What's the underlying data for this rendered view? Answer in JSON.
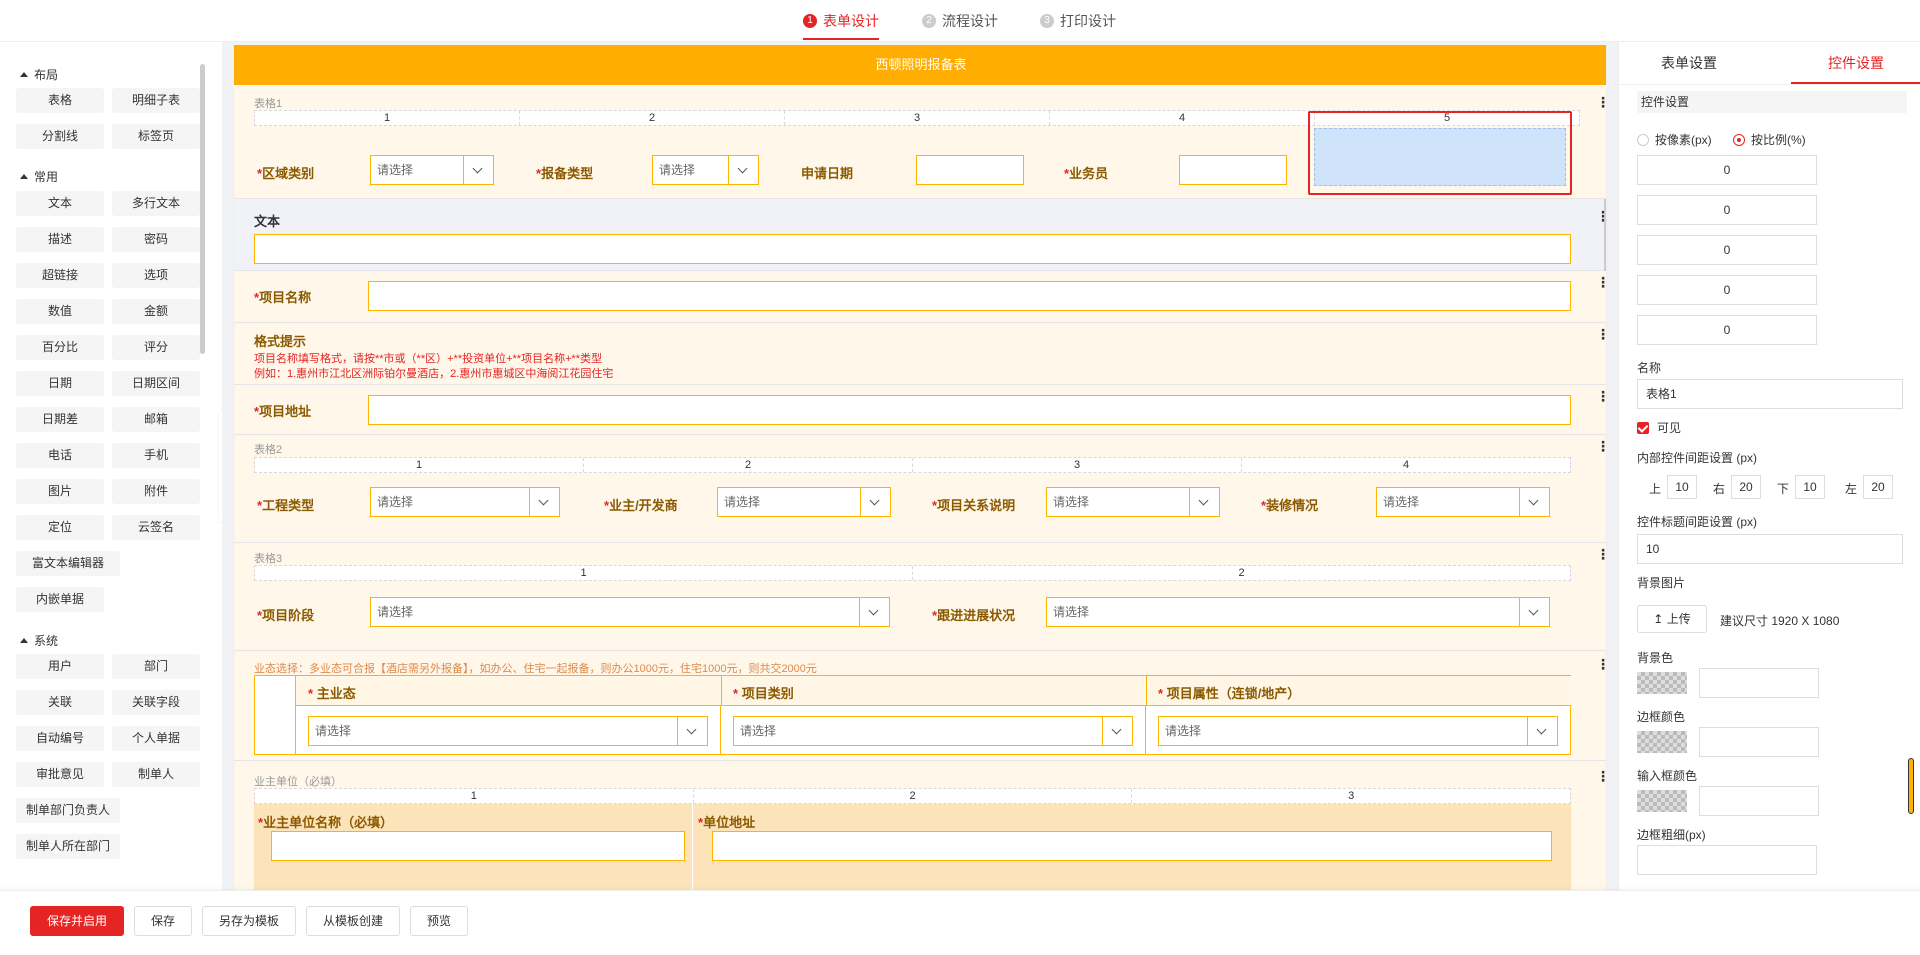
{
  "steps": [
    {
      "num": "1",
      "label": "表单设计"
    },
    {
      "num": "2",
      "label": "流程设计"
    },
    {
      "num": "3",
      "label": "打印设计"
    }
  ],
  "palette": {
    "groups": {
      "layout": "布局",
      "common": "常用",
      "system": "系统"
    },
    "layout": [
      "表格",
      "明细子表",
      "分割线",
      "标签页"
    ],
    "common": [
      "文本",
      "多行文本",
      "描述",
      "密码",
      "超链接",
      "选项",
      "数值",
      "金额",
      "百分比",
      "评分",
      "日期",
      "日期区间",
      "日期差",
      "邮箱",
      "电话",
      "手机",
      "图片",
      "附件",
      "定位",
      "云签名",
      "富文本编辑器",
      "内嵌单据"
    ],
    "system": [
      "用户",
      "部门",
      "关联",
      "关联字段",
      "自动编号",
      "个人单据",
      "审批意见",
      "制单人",
      "制单部门负责人",
      "制单人所在部门"
    ]
  },
  "form": {
    "title": "西顿照明报备表",
    "table1": {
      "label": "表格1",
      "cols": [
        "1",
        "2",
        "3",
        "4",
        "5"
      ],
      "fields": [
        {
          "label": "区域类别",
          "required": true,
          "type": "select",
          "value": "请选择"
        },
        {
          "label": "报备类型",
          "required": true,
          "type": "select",
          "value": "请选择"
        },
        {
          "label": "申请日期",
          "required": false,
          "type": "input",
          "value": ""
        },
        {
          "label": "业务员",
          "required": true,
          "type": "input",
          "value": ""
        }
      ]
    },
    "text_field": {
      "label": "文本"
    },
    "project_name": {
      "label": "项目名称"
    },
    "format_hint": {
      "title": "格式提示",
      "line1": "项目名称填写格式，请按**市或（**区）+**投资单位+**项目名称+**类型",
      "line2": "例如：1.惠州市江北区洲际铂尔曼酒店，2.惠州市惠城区中海阅江花园住宅"
    },
    "project_address": {
      "label": "项目地址"
    },
    "table2": {
      "label": "表格2",
      "cols": [
        "1",
        "2",
        "3",
        "4"
      ],
      "fields": [
        {
          "label": "工程类型",
          "value": "请选择"
        },
        {
          "label": "业主/开发商",
          "value": "请选择"
        },
        {
          "label": "项目关系说明",
          "value": "请选择"
        },
        {
          "label": "装修情况",
          "value": "请选择"
        }
      ]
    },
    "table3": {
      "label": "表格3",
      "cols": [
        "1",
        "2"
      ],
      "fields": [
        {
          "label": "项目阶段",
          "value": "请选择"
        },
        {
          "label": "跟进进展状况",
          "value": "请选择"
        }
      ]
    },
    "subtable": {
      "note": "业态选择：多业态可合报【酒店需另外报备】，如办公、住宅一起报备，则办公1000元，住宅1000元，则共交2000元",
      "cols": [
        "主业态",
        "项目类别",
        "项目属性（连锁/地产）"
      ],
      "value": "请选择"
    },
    "owner": {
      "label": "业主单位（必填）",
      "cols": [
        "1",
        "2",
        "3"
      ],
      "f1": "业主单位名称（必填）",
      "f2": "单位地址"
    }
  },
  "bottom": {
    "save_enable": "保存并启用",
    "save": "保存",
    "save_template": "另存为模板",
    "from_template": "从模板创建",
    "preview": "预览"
  },
  "right": {
    "tabs": [
      "表单设置",
      "控件设置"
    ],
    "section": "控件设置",
    "unit_px": "按像素(px)",
    "unit_pct": "按比例(%)",
    "ratios": [
      "0",
      "0",
      "0",
      "0",
      "0"
    ],
    "name_label": "名称",
    "name_value": "表格1",
    "visible": "可见",
    "inner_label": "内部控件间距设置 (px)",
    "pads": [
      {
        "k": "上",
        "v": "10"
      },
      {
        "k": "右",
        "v": "20"
      },
      {
        "k": "下",
        "v": "10"
      },
      {
        "k": "左",
        "v": "20"
      }
    ],
    "title_gap_label": "控件标题间距设置 (px)",
    "title_gap_value": "10",
    "bg_image": "背景图片",
    "upload": "上传",
    "upload_hint": "建议尺寸 1920 X 1080",
    "bg_color": "背景色",
    "border_color": "边框颜色",
    "input_border_color": "输入框颜色",
    "border_width": "边框粗细(px)"
  },
  "colors": {
    "accent": "#e52424",
    "header": "#ffad00",
    "field_border": "#ffb400",
    "canvas": "#fef7ea"
  }
}
